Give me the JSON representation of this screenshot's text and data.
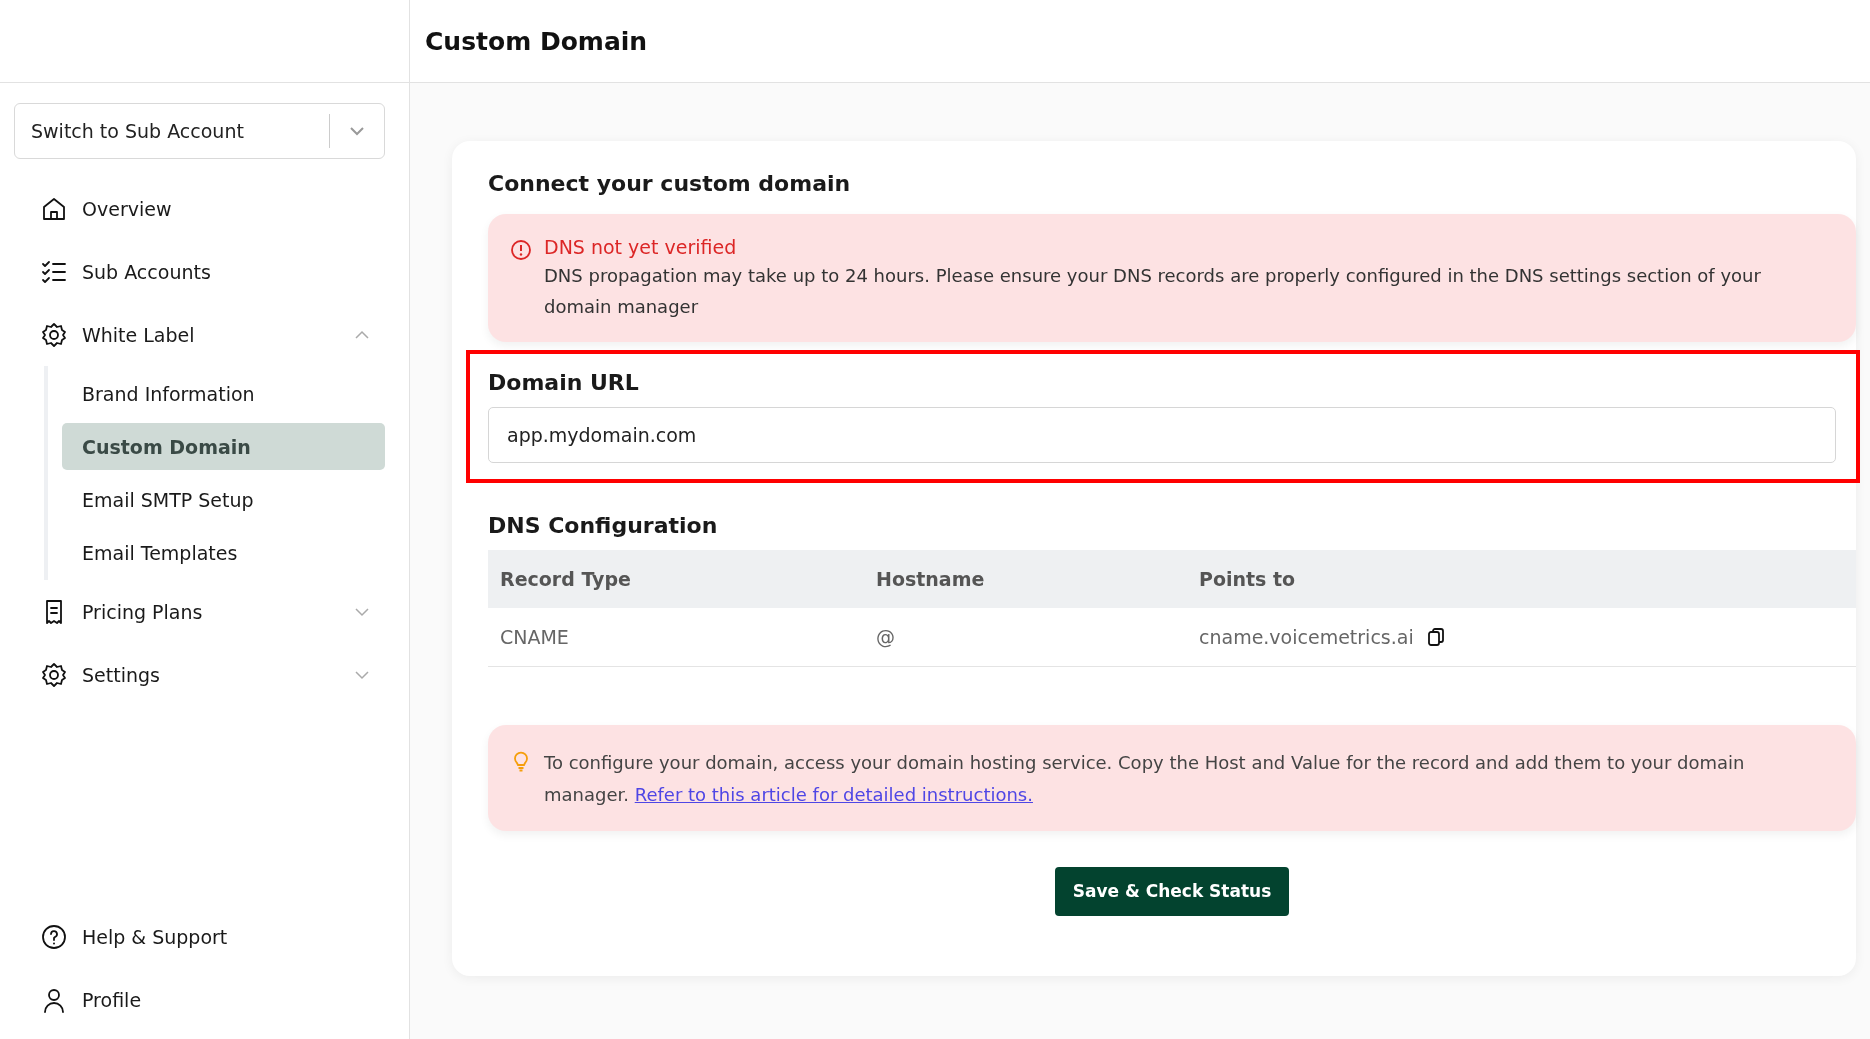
{
  "header": {
    "title": "Custom Domain"
  },
  "sidebar": {
    "account_switcher": {
      "value": "Switch to Sub Account"
    },
    "items": [
      {
        "label": "Overview"
      },
      {
        "label": "Sub Accounts"
      },
      {
        "label": "White Label",
        "expanded": true,
        "children": [
          {
            "label": "Brand Information",
            "selected": false
          },
          {
            "label": "Custom Domain",
            "selected": true
          },
          {
            "label": "Email SMTP Setup",
            "selected": false
          },
          {
            "label": "Email Templates",
            "selected": false
          }
        ]
      },
      {
        "label": "Pricing Plans",
        "expanded": false
      },
      {
        "label": "Settings",
        "expanded": false
      }
    ],
    "footer_items": [
      {
        "label": "Help & Support"
      },
      {
        "label": "Profile"
      }
    ]
  },
  "card": {
    "title": "Connect your custom domain",
    "alert": {
      "title": "DNS not yet verified",
      "message": "DNS propagation may take up to 24 hours. Please ensure your DNS records are properly configured in the DNS settings section of your domain manager"
    },
    "domain_field": {
      "label": "Domain URL",
      "value": "app.mydomain.com",
      "highlighted": true
    },
    "dns": {
      "title": "DNS Configuration",
      "columns": [
        "Record Type",
        "Hostname",
        "Points to"
      ],
      "rows": [
        [
          "CNAME",
          "@",
          "cname.voicemetrics.ai"
        ]
      ]
    },
    "tip": {
      "text": "To configure your domain, access your domain hosting service. Copy the Host and Value for the record and add them to your domain manager.",
      "link": "Refer to this article for detailed instructions."
    },
    "button": "Save & Check Status"
  }
}
